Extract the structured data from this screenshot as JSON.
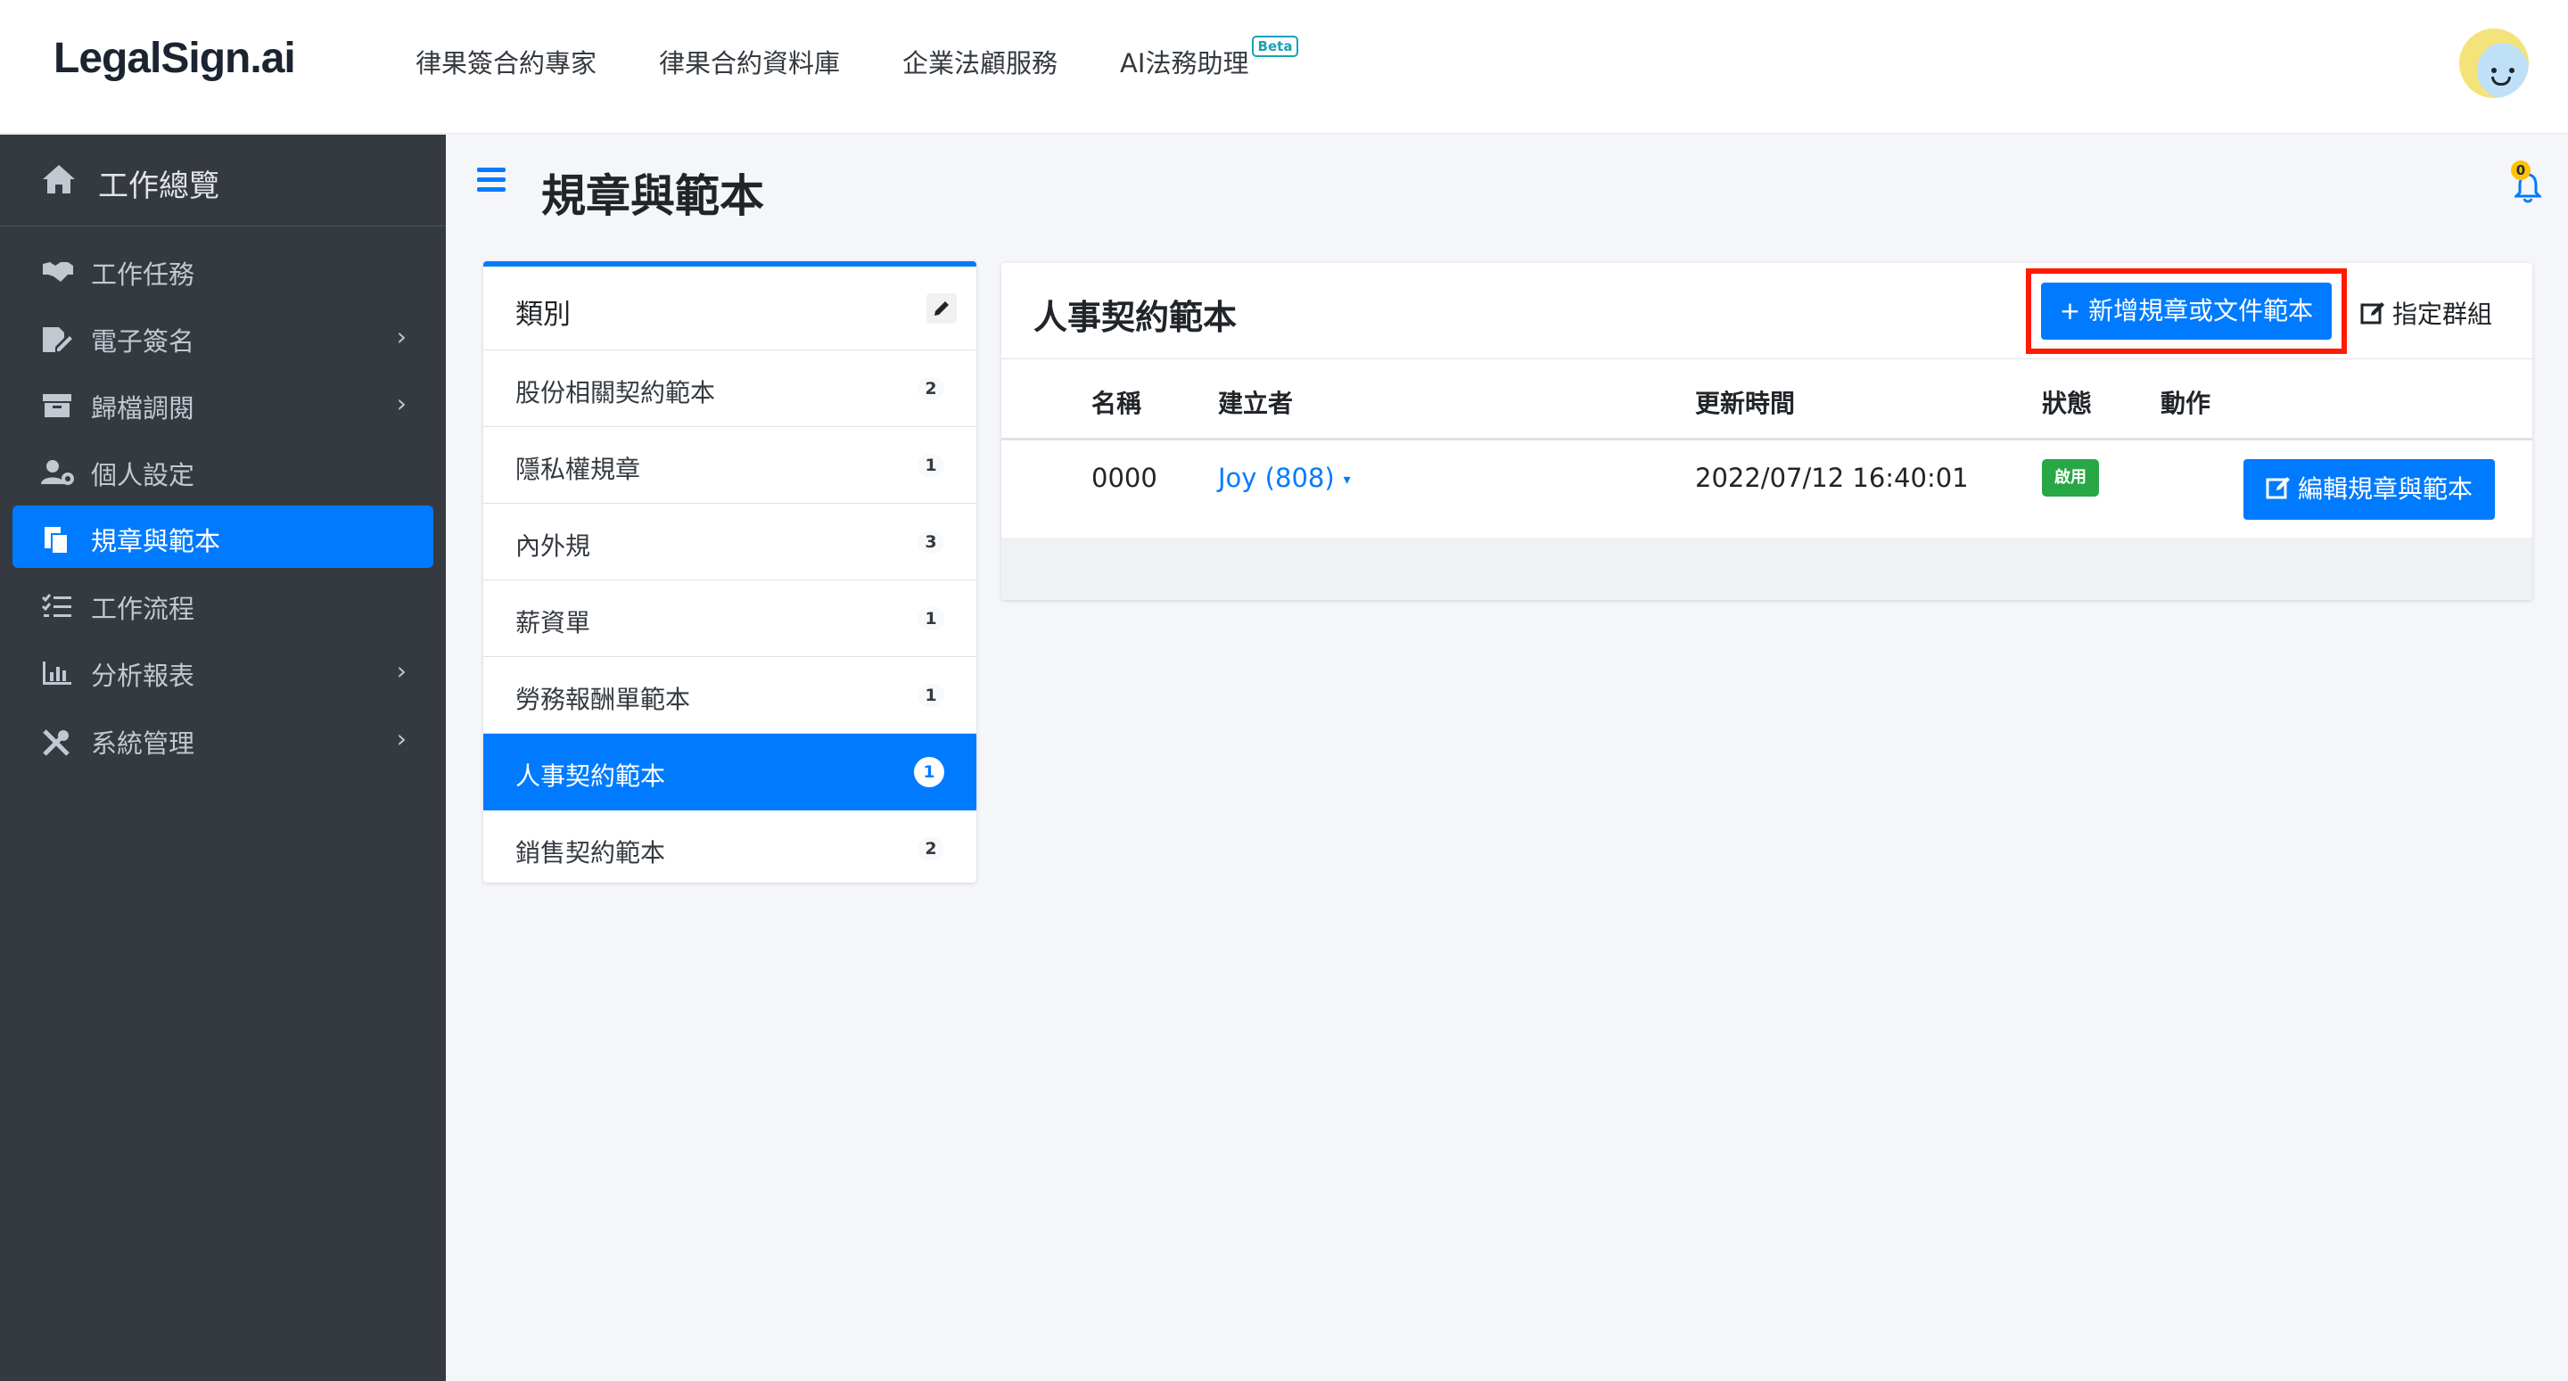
{
  "brand": {
    "logo_text": "LegalSign.ai"
  },
  "topnav": {
    "items": [
      "律果簽合約專家",
      "律果合約資料庫",
      "企業法顧服務",
      "AI法務助理"
    ],
    "beta_badge": "Beta"
  },
  "sidebar": {
    "home_label": "工作總覽",
    "items": [
      {
        "label": "工作任務",
        "icon": "handshake-icon",
        "has_children": false
      },
      {
        "label": "電子簽名",
        "icon": "signature-icon",
        "has_children": true
      },
      {
        "label": "歸檔調閱",
        "icon": "archive-icon",
        "has_children": true
      },
      {
        "label": "個人設定",
        "icon": "user-gear-icon",
        "has_children": false
      },
      {
        "label": "規章與範本",
        "icon": "copy-icon",
        "has_children": false,
        "active": true
      },
      {
        "label": "工作流程",
        "icon": "tasks-icon",
        "has_children": false
      },
      {
        "label": "分析報表",
        "icon": "chart-icon",
        "has_children": true
      },
      {
        "label": "系統管理",
        "icon": "tools-icon",
        "has_children": true
      }
    ]
  },
  "header": {
    "page_title": "規章與範本",
    "notification_count": "0"
  },
  "categories": {
    "title": "類別",
    "items": [
      {
        "label": "股份相關契約範本",
        "count": "2"
      },
      {
        "label": "隱私權規章",
        "count": "1"
      },
      {
        "label": "內外規",
        "count": "3"
      },
      {
        "label": "薪資單",
        "count": "1"
      },
      {
        "label": "勞務報酬單範本",
        "count": "1"
      },
      {
        "label": "人事契約範本",
        "count": "1",
        "active": true
      },
      {
        "label": "銷售契約範本",
        "count": "2"
      }
    ]
  },
  "main": {
    "title": "人事契約範本",
    "add_button": "新增規章或文件範本",
    "group_button": "指定群組",
    "columns": [
      "名稱",
      "建立者",
      "更新時間",
      "狀態",
      "動作"
    ],
    "rows": [
      {
        "name": "0000",
        "creator": "Joy (808)",
        "updated": "2022/07/12 16:40:01",
        "status": "啟用",
        "action": "編輯規章與範本"
      }
    ]
  },
  "colors": {
    "accent": "#007bff",
    "sidebar_bg": "#343a40",
    "success": "#28a745",
    "highlight": "#ff1a00"
  }
}
